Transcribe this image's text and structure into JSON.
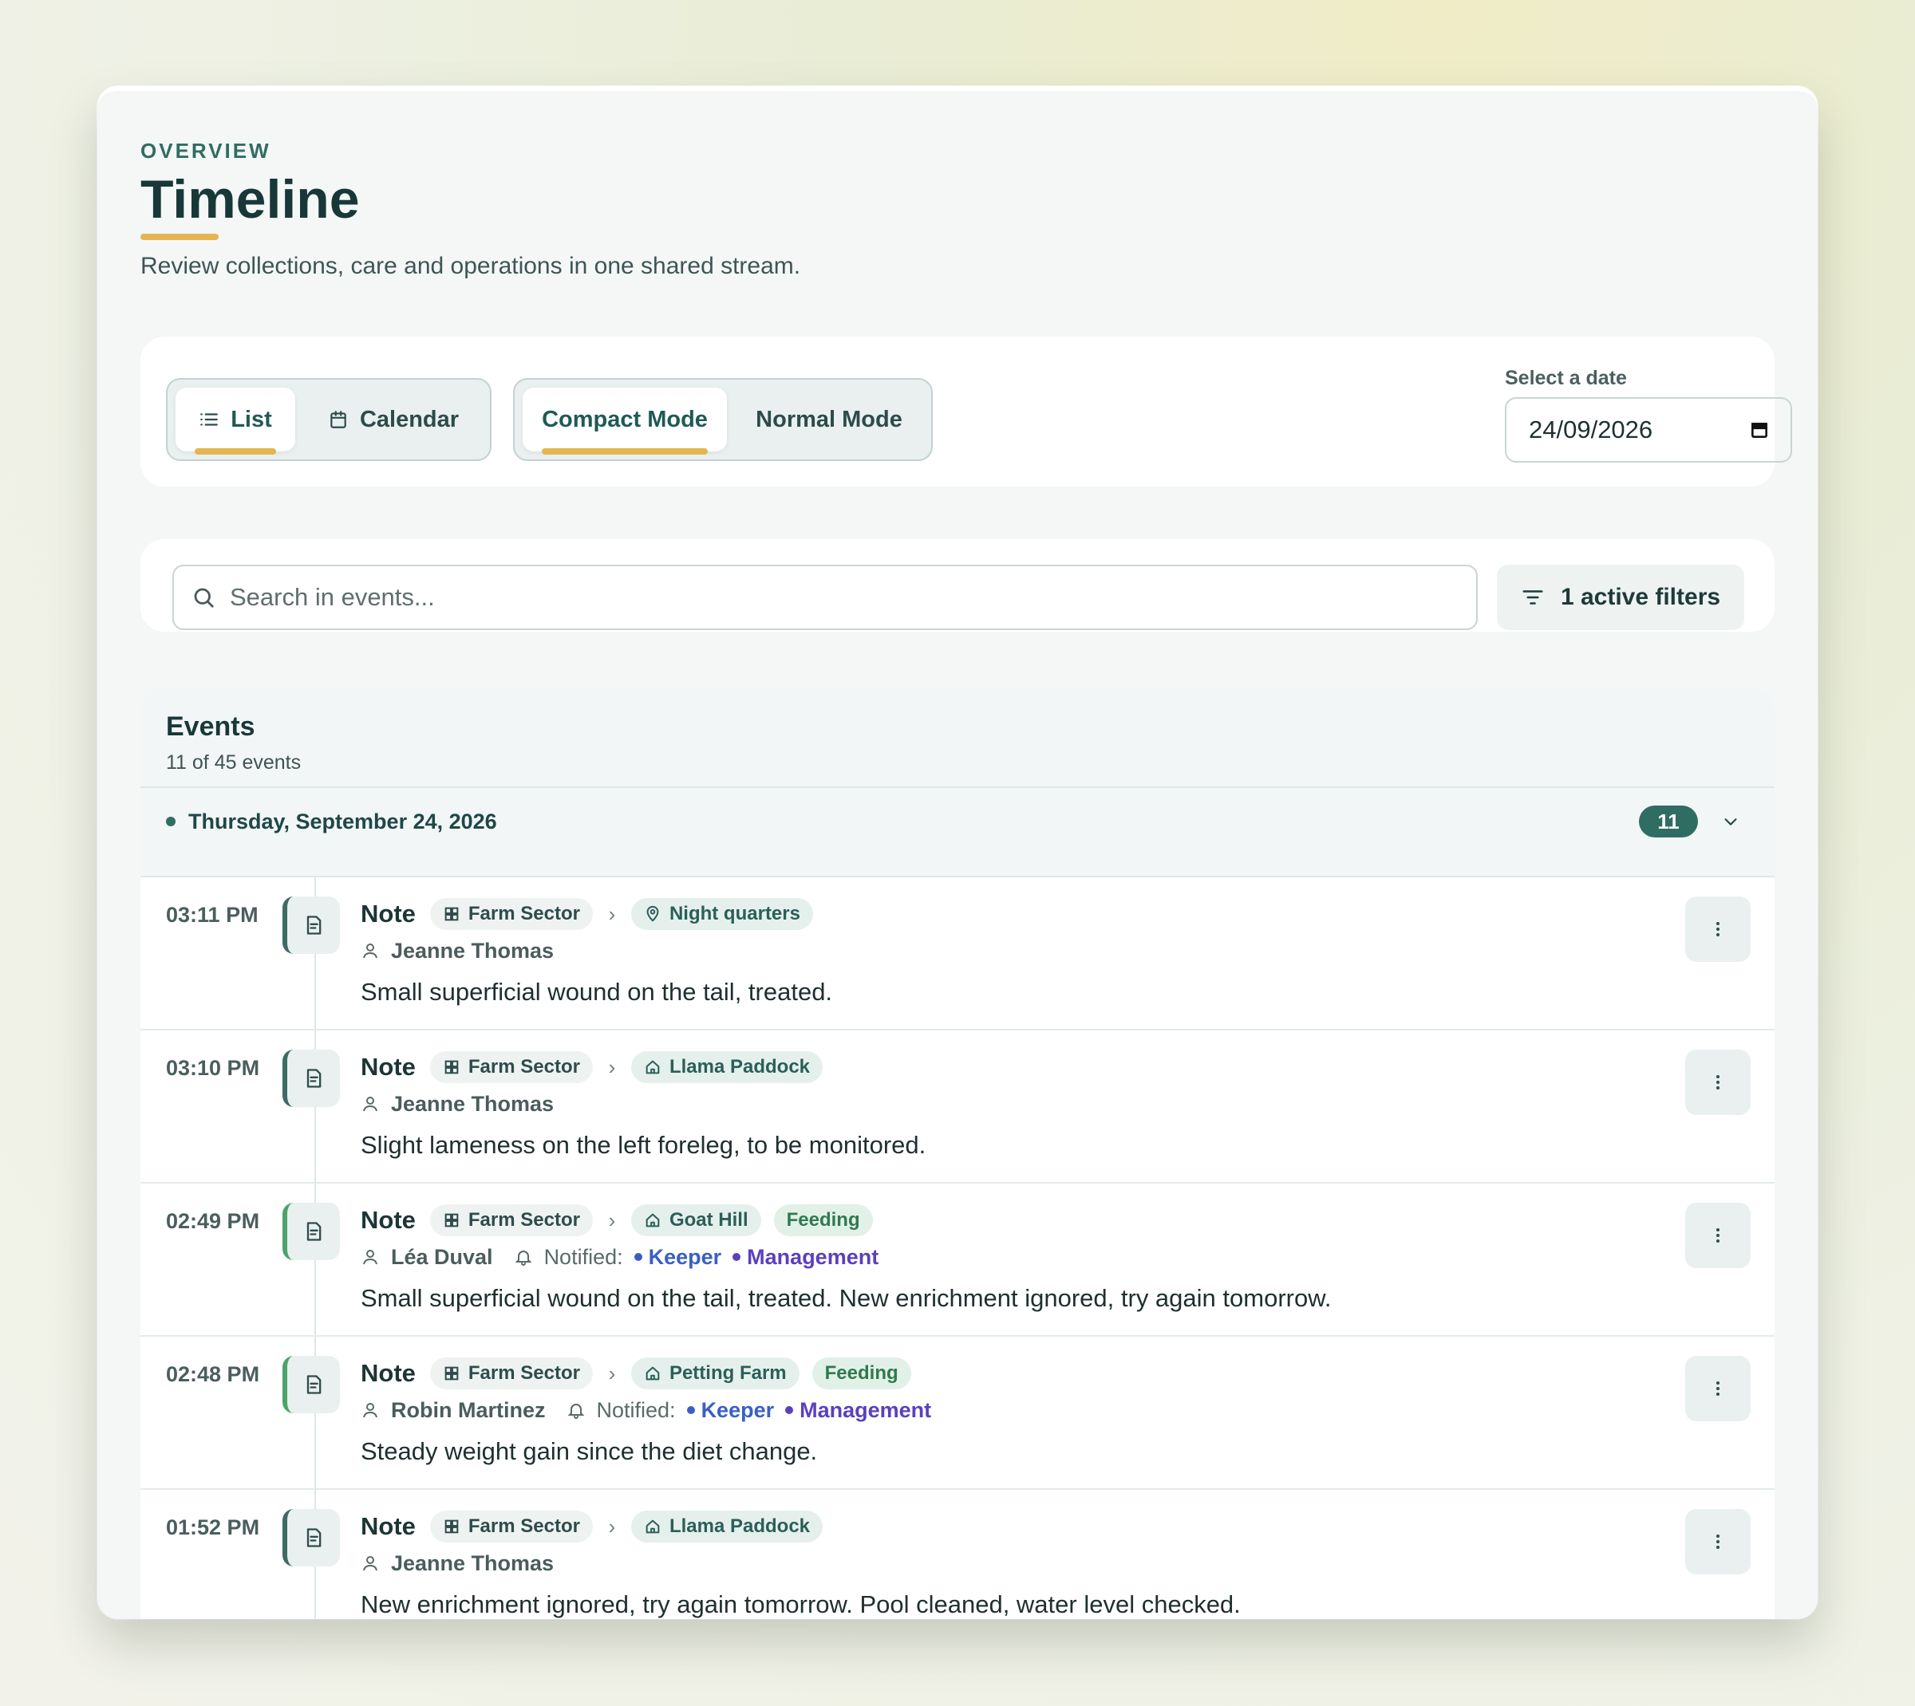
{
  "header": {
    "overline": "OVERVIEW",
    "title": "Timeline",
    "subtitle": "Review collections, care and operations in one shared stream."
  },
  "view_toggle": {
    "list": "List",
    "calendar": "Calendar",
    "selected": "List"
  },
  "mode_toggle": {
    "compact": "Compact Mode",
    "normal": "Normal Mode",
    "selected": "Compact Mode"
  },
  "date_picker": {
    "label": "Select a date",
    "value": "24/09/2026"
  },
  "search": {
    "placeholder": "Search in events..."
  },
  "filters": {
    "label": "1 active filters"
  },
  "events_panel": {
    "title": "Events",
    "count_text": "11 of 45 events",
    "day_group": {
      "label": "Thursday, September 24, 2026",
      "badge": "11"
    },
    "items": [
      {
        "time": "03:11 PM",
        "type": "Note",
        "sector": "Farm Sector",
        "location": "Night quarters",
        "location_icon": "map-pin-icon",
        "tag": "",
        "person": "Jeanne Thomas",
        "notified_label": "",
        "recipients": [],
        "description": "Small superficial wound on the tail, treated."
      },
      {
        "time": "03:10 PM",
        "type": "Note",
        "sector": "Farm Sector",
        "location": "Llama Paddock",
        "location_icon": "home-icon",
        "tag": "",
        "person": "Jeanne Thomas",
        "notified_label": "",
        "recipients": [],
        "description": "Slight lameness on the left foreleg, to be monitored."
      },
      {
        "time": "02:49 PM",
        "type": "Note",
        "sector": "Farm Sector",
        "location": "Goat Hill",
        "location_icon": "home-icon",
        "tag": "Feeding",
        "person": "Léa Duval",
        "notified_label": "Notified:",
        "recipients": [
          "Keeper",
          "Management"
        ],
        "description": "Small superficial wound on the tail, treated. New enrichment ignored, try again tomorrow."
      },
      {
        "time": "02:48 PM",
        "type": "Note",
        "sector": "Farm Sector",
        "location": "Petting Farm",
        "location_icon": "home-icon",
        "tag": "Feeding",
        "person": "Robin Martinez",
        "notified_label": "Notified:",
        "recipients": [
          "Keeper",
          "Management"
        ],
        "description": "Steady weight gain since the diet change."
      },
      {
        "time": "01:52 PM",
        "type": "Note",
        "sector": "Farm Sector",
        "location": "Llama Paddock",
        "location_icon": "home-icon",
        "tag": "",
        "person": "Jeanne Thomas",
        "notified_label": "",
        "recipients": [],
        "description": "New enrichment ignored, try again tomorrow. Pool cleaned, water level checked."
      }
    ]
  },
  "colors": {
    "accent": "#2f6d62",
    "highlight": "#e3b651",
    "keeper": "#3a5fc4",
    "management": "#5b3fbf",
    "tag_green": "#2f7a50"
  }
}
